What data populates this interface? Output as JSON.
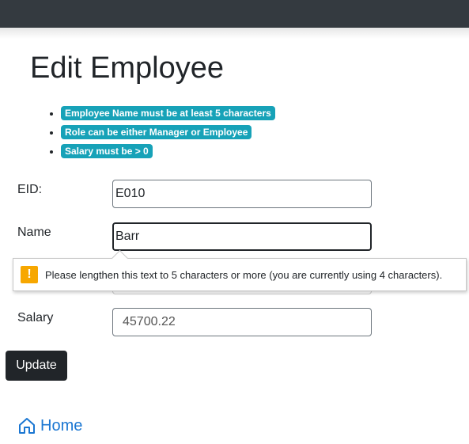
{
  "title": "Edit Employee",
  "rules": [
    "Employee Name must be at least 5 characters",
    "Role can be either Manager or Employee",
    "Salary must be > 0"
  ],
  "form": {
    "eid_label": "EID:",
    "eid_value": "E010",
    "name_label": "Name",
    "name_value": "Barr",
    "salary_label": "Salary",
    "salary_value": "45700.22"
  },
  "validation_tooltip": "Please lengthen this text to 5 characters or more (you are currently using 4 characters).",
  "update_button": "Update",
  "home_link": "Home",
  "colors": {
    "badge": "#17a2b8",
    "navbar": "#343a40",
    "warning": "#f7a700",
    "link": "#1a76d2"
  }
}
